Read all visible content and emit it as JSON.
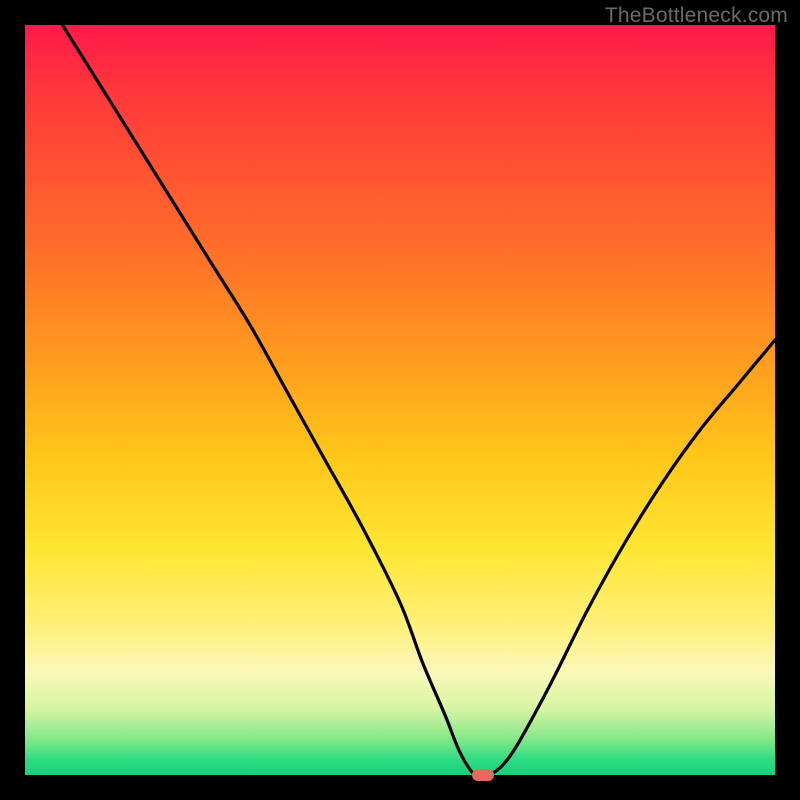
{
  "watermark": "TheBottleneck.com",
  "chart_data": {
    "type": "line",
    "title": "",
    "xlabel": "",
    "ylabel": "",
    "xlim": [
      0,
      100
    ],
    "ylim": [
      0,
      100
    ],
    "grid": false,
    "legend": false,
    "series": [
      {
        "name": "bottleneck-curve",
        "x": [
          5,
          10,
          15,
          20,
          25,
          30,
          35,
          40,
          45,
          50,
          53,
          56,
          58,
          60,
          62,
          65,
          70,
          75,
          80,
          85,
          90,
          95,
          100
        ],
        "y": [
          100,
          92,
          84,
          76,
          68,
          60,
          51,
          42,
          33,
          23,
          15,
          8,
          3,
          0,
          0,
          3,
          12,
          22,
          31,
          39,
          46,
          52,
          58
        ]
      }
    ],
    "marker": {
      "x": 61,
      "y": 0,
      "color": "#e46a5e"
    },
    "gradient_stops": [
      {
        "pos": 0,
        "color": "#ff1a4a"
      },
      {
        "pos": 10,
        "color": "#ff3a3a"
      },
      {
        "pos": 22,
        "color": "#ff5a30"
      },
      {
        "pos": 34,
        "color": "#ff7a26"
      },
      {
        "pos": 46,
        "color": "#ffa01e"
      },
      {
        "pos": 58,
        "color": "#ffc81a"
      },
      {
        "pos": 70,
        "color": "#ffe633"
      },
      {
        "pos": 80,
        "color": "#fff07a"
      },
      {
        "pos": 86,
        "color": "#fcf8b8"
      },
      {
        "pos": 91,
        "color": "#d8f5a5"
      },
      {
        "pos": 95,
        "color": "#8ae88a"
      },
      {
        "pos": 98,
        "color": "#2edc82"
      },
      {
        "pos": 100,
        "color": "#16d17c"
      }
    ]
  }
}
